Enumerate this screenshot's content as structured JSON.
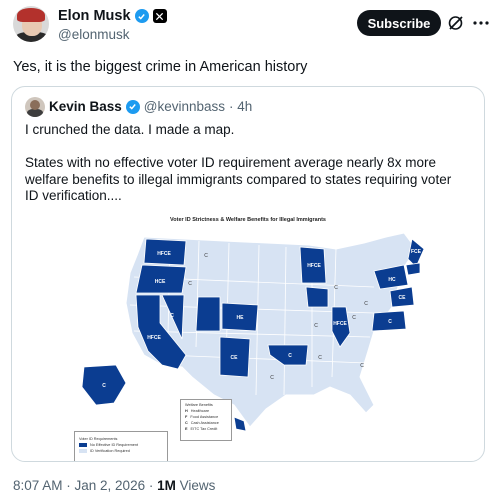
{
  "post": {
    "author_name": "Elon Musk",
    "author_handle": "@elonmusk",
    "subscribe_label": "Subscribe",
    "text": "Yes, it is the biggest crime in American history",
    "timestamp": "8:07 AM · Jan 2, 2026 ·",
    "views_count": "1M",
    "views_label": "Views"
  },
  "quoted": {
    "author_name": "Kevin Bass",
    "author_handle": "@kevinnbass",
    "age": "· 4h",
    "line1": "I crunched the data. I made a map.",
    "body": "States with no effective voter ID requirement average nearly 8x more welfare benefits to illegal immigrants compared to states requiring voter ID verification....",
    "map": {
      "title": "Voter ID Strictness & Welfare Benefits for Illegal Immigrants",
      "legend_id_title": "Voter ID Requirements",
      "legend_id_none": "No Effective ID Requirement",
      "legend_id_required": "ID Verification Required",
      "legend_benefit_title": "Welfare Benefits",
      "benefit_h": "Healthcare",
      "benefit_f": "Food Assistance",
      "benefit_c": "Cash Assistance",
      "benefit_e": "EITC Tax Credit",
      "key_h": "H",
      "key_f": "F",
      "key_c": "C",
      "key_e": "E",
      "dark_color": "#0b3d91",
      "light_color": "#d7e3f3",
      "labels": {
        "wa": "HFCE",
        "or": "HCE",
        "ca": "HFCE",
        "co": "HE",
        "nm": "CE",
        "ok": "C",
        "mn": "HFCE",
        "il": "HFCE",
        "me": "FCE",
        "ny": "HC",
        "mt": "C",
        "id": "C",
        "tx": "C",
        "ar": "C",
        "mo": "C",
        "oh": "C",
        "wi": "C",
        "in": "C",
        "ga": "C",
        "pa": "CE",
        "va": "C",
        "ak": "C",
        "nv": "C"
      }
    }
  }
}
